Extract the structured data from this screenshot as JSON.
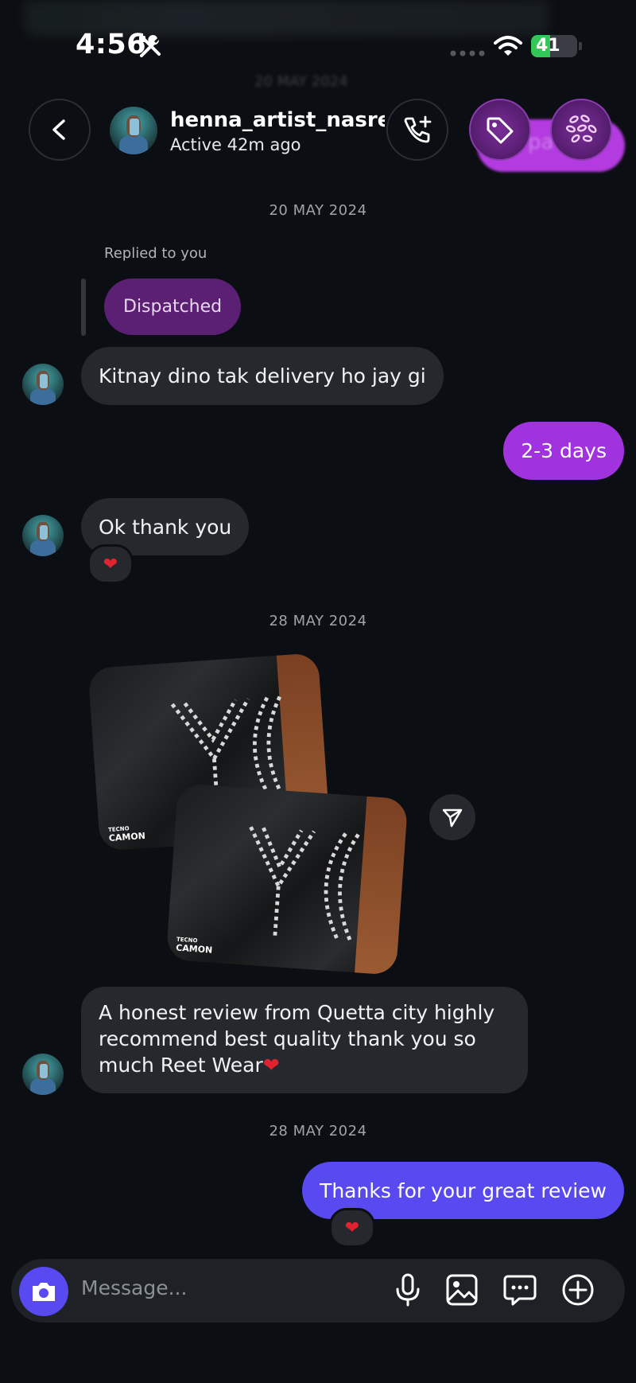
{
  "status_bar": {
    "time": "4:56",
    "battery": "41",
    "battery_level": 0.41
  },
  "header": {
    "ghost_date": "20 MAY 2024",
    "username": "henna_artist_nasre...",
    "active_status": "Active 42m ago",
    "pill_label": "pa"
  },
  "messages": {
    "date_1": "20 MAY 2024",
    "replied_label": "Replied to you",
    "replied_message": "Dispatched",
    "msg_1": "Kitnay dino tak delivery ho jay gi",
    "msg_2": "2-3 days",
    "msg_3": "Ok thank you",
    "reaction_1": "❤",
    "date_2": "28 MAY 2024",
    "photo_brand": "CAMON",
    "photo_brand_small": "TECNO",
    "msg_4": "A honest review from Quetta city highly recommend best quality thank you so much Reet Wear",
    "msg_4_emoji": "❤",
    "date_3": "28 MAY 2024",
    "msg_5": "Thanks for your great review",
    "reaction_2": "❤"
  },
  "composer": {
    "placeholder": "Message..."
  },
  "colors": {
    "accent_purple": "#a033de",
    "accent_blue": "#5949f0",
    "bubble_in": "#25282d",
    "background": "#0b0e12"
  }
}
